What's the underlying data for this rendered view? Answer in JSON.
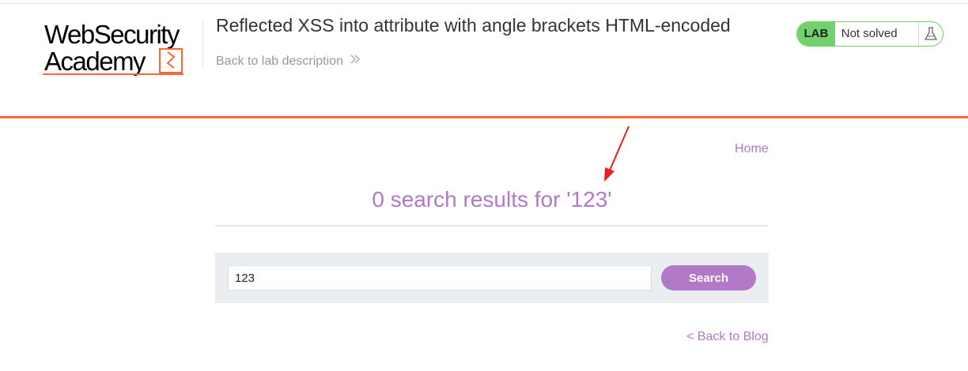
{
  "logo": {
    "line1": "WebSecurity",
    "line2": "Academy",
    "brand_color": "#ff6633"
  },
  "header": {
    "lab_title": "Reflected XSS into attribute with angle brackets HTML-encoded",
    "back_link": "Back to lab description",
    "back_icon": "double-chevron-right-icon"
  },
  "status": {
    "badge": "LAB",
    "state": "Not solved",
    "icon": "flask-icon",
    "color": "#70d16d"
  },
  "nav": {
    "home": "Home"
  },
  "results": {
    "heading": "0 search results for '123'"
  },
  "search": {
    "value": "123",
    "button": "Search"
  },
  "footer": {
    "back_blog": "< Back to Blog"
  },
  "colors": {
    "accent": "#b179c8",
    "divider": "#ff6633",
    "panel": "#eaeef1",
    "annotation": "#ee1c1c"
  }
}
